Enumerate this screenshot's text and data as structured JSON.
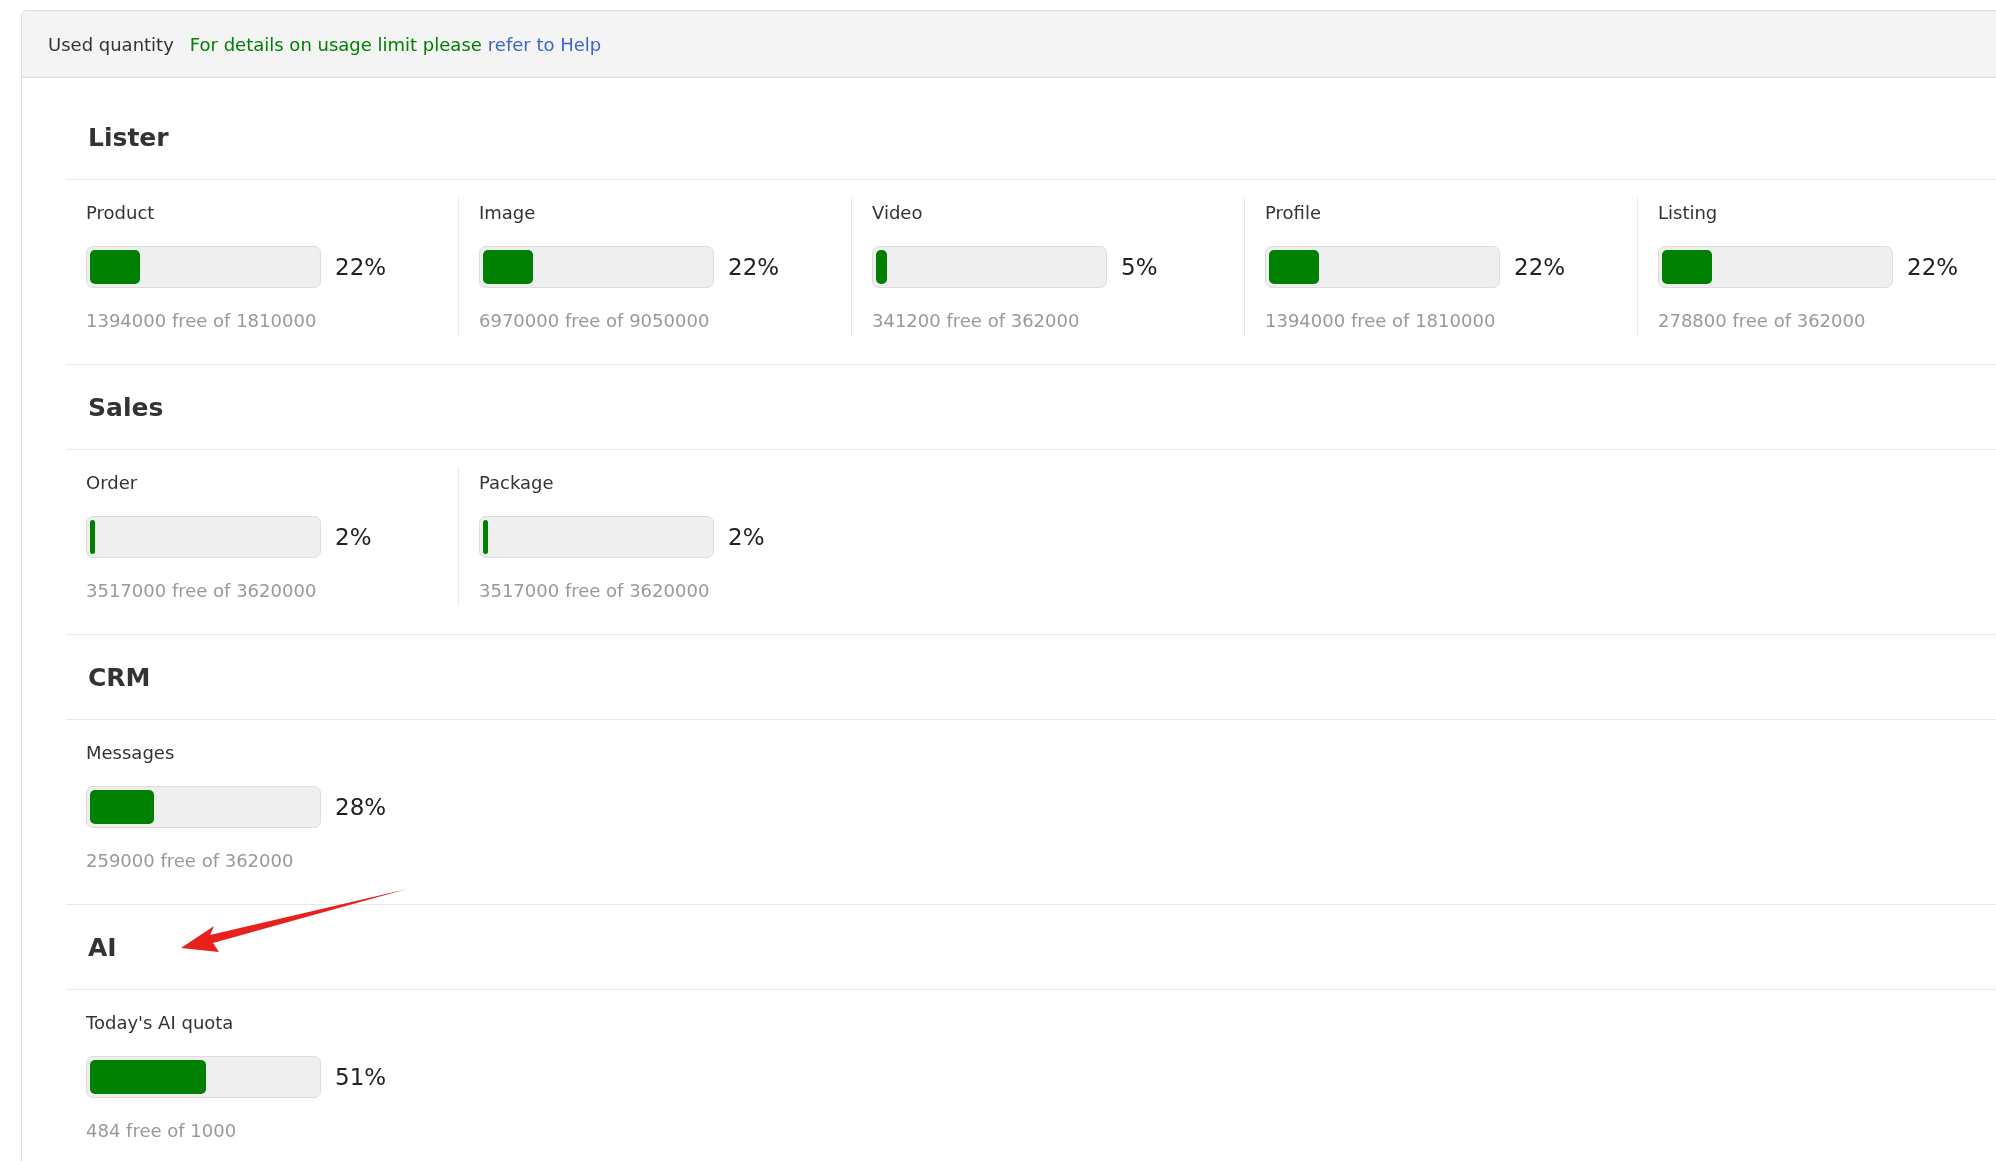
{
  "header": {
    "label": "Used quantity",
    "note": "For details on usage limit please",
    "link": "refer to Help"
  },
  "sections": [
    {
      "title": "Lister",
      "items": [
        {
          "label": "Product",
          "level": 0.22,
          "percent": "22%",
          "free": "1394000 free of 1810000"
        },
        {
          "label": "Image",
          "level": 0.22,
          "percent": "22%",
          "free": "6970000 free of 9050000"
        },
        {
          "label": "Video",
          "level": 0.05,
          "percent": "5%",
          "free": "341200 free of 362000"
        },
        {
          "label": "Profile",
          "level": 0.22,
          "percent": "22%",
          "free": "1394000 free of 1810000"
        },
        {
          "label": "Listing",
          "level": 0.22,
          "percent": "22%",
          "free": "278800 free of 362000"
        }
      ]
    },
    {
      "title": "Sales",
      "items": [
        {
          "label": "Order",
          "level": 0.02,
          "percent": "2%",
          "free": "3517000 free of 3620000"
        },
        {
          "label": "Package",
          "level": 0.02,
          "percent": "2%",
          "free": "3517000 free of 3620000"
        }
      ]
    },
    {
      "title": "CRM",
      "items": [
        {
          "label": "Messages",
          "level": 0.28,
          "percent": "28%",
          "free": "259000 free of 362000"
        }
      ]
    },
    {
      "title": "AI",
      "items": [
        {
          "label": "Today's AI quota",
          "level": 0.51,
          "percent": "51%",
          "free": "484 free of 1000"
        }
      ]
    }
  ]
}
